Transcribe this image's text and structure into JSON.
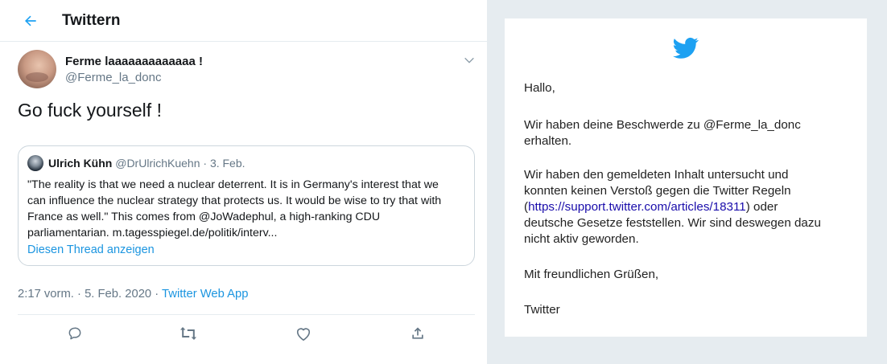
{
  "tweet_view": {
    "header_title": "Twittern",
    "author": {
      "name": "Ferme laaaaaaaaaaaaa !",
      "handle": "@Ferme_la_donc"
    },
    "text": "Go fuck yourself !",
    "quoted": {
      "name": "Ulrich Kühn",
      "handle": "@DrUlrichKuehn",
      "separator": " · ",
      "date": "3. Feb.",
      "lines": [
        "\"The reality is that we need a nuclear deterrent. It is in Germany's interest that we",
        "can influence the nuclear strategy that protects us. It would be wise to try that with",
        "France as well.\" This comes from @JoWadephul, a high-ranking CDU",
        "parliamentarian. m.tagesspiegel.de/politik/interv..."
      ],
      "thread_link": "Diesen Thread anzeigen"
    },
    "meta": {
      "time": "2:17 vorm.",
      "separator": " · ",
      "date": "5. Feb. 2020",
      "source": "Twitter Web App"
    },
    "actions": [
      "reply-icon",
      "retweet-icon",
      "like-icon",
      "share-icon"
    ]
  },
  "email": {
    "greeting": "Hallo,",
    "line_received_1": "Wir haben deine Beschwerde zu @Ferme_la_donc",
    "line_received_2": "erhalten.",
    "body_1": "Wir haben den gemeldeten Inhalt untersucht und",
    "body_2": "konnten keinen Verstoß gegen die Twitter Regeln",
    "body_3_open": "(",
    "body_3_link": "https://support.twitter.com/articles/18311",
    "body_3_close": ") oder",
    "body_4": "deutsche Gesetze feststellen. Wir sind deswegen dazu",
    "body_5": "nicht aktiv geworden.",
    "closing": "Mit freundlichen Grüßen,",
    "signature": "Twitter"
  },
  "colors": {
    "twitter_blue": "#1da1f2",
    "link_blue": "#1b95e0",
    "text": "#14171a",
    "secondary_text": "#657786",
    "panel_bg": "#e6ecf0"
  }
}
